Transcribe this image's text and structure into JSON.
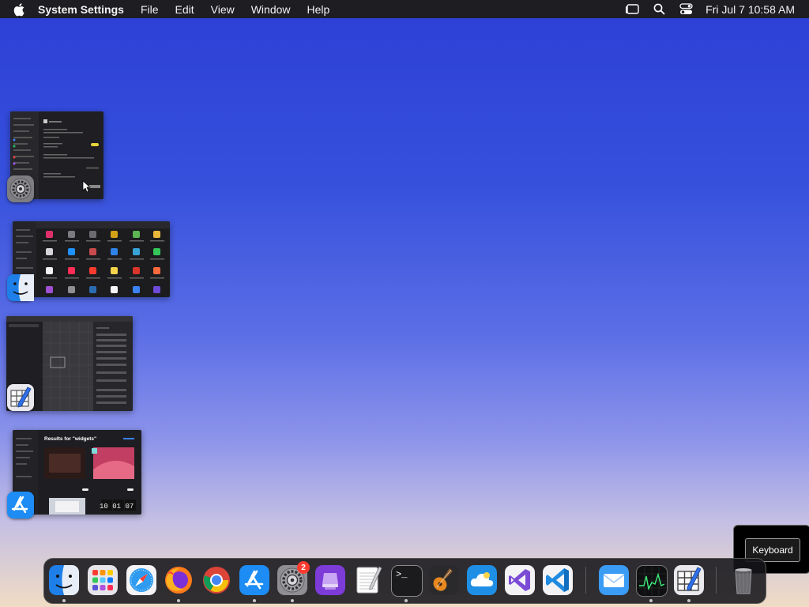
{
  "menubar": {
    "app_name": "System Settings",
    "menus": [
      "File",
      "Edit",
      "View",
      "Window",
      "Help"
    ],
    "clock": "Fri Jul 7  10:58 AM"
  },
  "expose": {
    "windows": [
      {
        "app": "System Settings",
        "icon": "gear-icon"
      },
      {
        "app": "Finder",
        "icon": "finder-icon"
      },
      {
        "app": "Grid editor",
        "icon": "grid-pencil-icon"
      },
      {
        "app": "App Store",
        "icon": "app-store-icon"
      }
    ]
  },
  "store_thumbnail": {
    "heading": "Results for \"widgets\"",
    "clock_digits": [
      "10",
      "01",
      "07"
    ]
  },
  "tooltip": {
    "label": "Keyboard"
  },
  "dock": {
    "items": [
      {
        "name": "finder",
        "icon": "finder-icon",
        "running": true
      },
      {
        "name": "launchpad",
        "icon": "launchpad-icon",
        "running": false
      },
      {
        "name": "safari",
        "icon": "safari-icon",
        "running": false
      },
      {
        "name": "firefox",
        "icon": "firefox-icon",
        "running": true
      },
      {
        "name": "chrome",
        "icon": "chrome-icon",
        "running": false
      },
      {
        "name": "app-store",
        "icon": "app-store-icon",
        "running": true
      },
      {
        "name": "system-settings",
        "icon": "gear-icon",
        "running": true
      },
      {
        "name": "podcasts",
        "icon": "podcasts-icon",
        "running": false
      },
      {
        "name": "textedit",
        "icon": "textedit-icon",
        "running": false
      },
      {
        "name": "terminal",
        "icon": "terminal-icon",
        "running": true
      },
      {
        "name": "garageband",
        "icon": "guitar-icon",
        "running": false
      },
      {
        "name": "icloud",
        "icon": "cloud-icon",
        "running": false
      },
      {
        "name": "visual-studio",
        "icon": "visual-studio-icon",
        "running": false
      },
      {
        "name": "vscode",
        "icon": "vscode-icon",
        "running": false
      },
      {
        "name": "mail",
        "icon": "mail-icon",
        "running": false
      },
      {
        "name": "activity-monitor",
        "icon": "activity-monitor-icon",
        "running": true
      },
      {
        "name": "grid-editor",
        "icon": "grid-pencil-icon",
        "running": true
      },
      {
        "name": "trash",
        "icon": "trash-icon",
        "running": false
      }
    ],
    "settings_badge": "2",
    "terminal_prompt": ">_"
  },
  "colors": {
    "menubar_bg": "#1d1d22",
    "desktop_top": "#2d3fd6",
    "desktop_bottom": "#f0dcc4",
    "badge_red": "#ff3b30"
  }
}
